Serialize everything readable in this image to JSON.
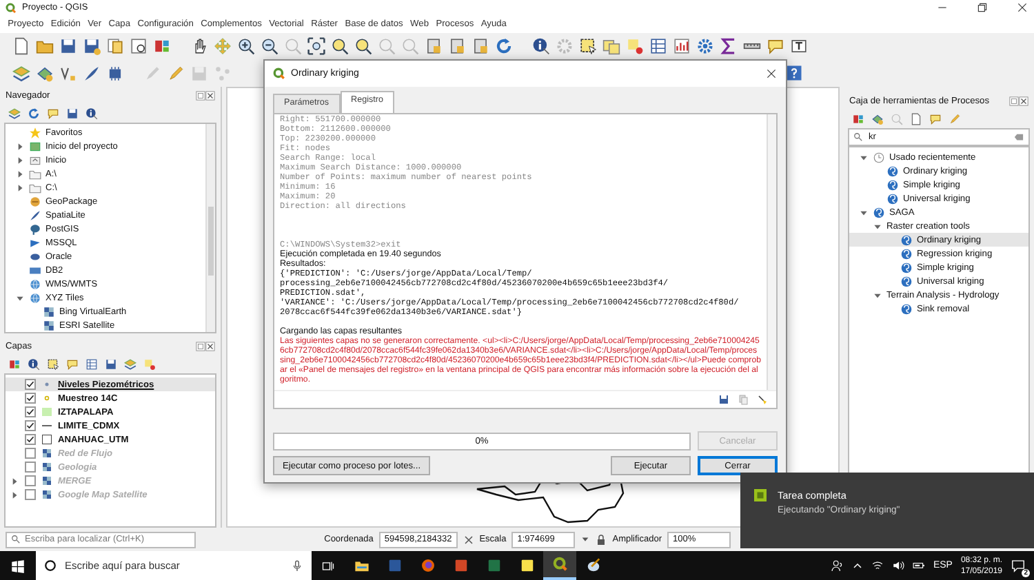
{
  "window": {
    "title": "Proyecto - QGIS"
  },
  "menu": [
    "Proyecto",
    "Edición",
    "Ver",
    "Capa",
    "Configuración",
    "Complementos",
    "Vectorial",
    "Ráster",
    "Base de datos",
    "Web",
    "Procesos",
    "Ayuda"
  ],
  "browser": {
    "title": "Navegador",
    "items": [
      {
        "label": "Favoritos",
        "kind": "favorites"
      },
      {
        "label": "Inicio del proyecto",
        "kind": "project",
        "expanded": false
      },
      {
        "label": "Inicio",
        "kind": "home",
        "expanded": false
      },
      {
        "label": "A:\\",
        "kind": "folder",
        "expanded": false
      },
      {
        "label": "C:\\",
        "kind": "folder",
        "expanded": false
      },
      {
        "label": "GeoPackage",
        "kind": "geopackage"
      },
      {
        "label": "SpatiaLite",
        "kind": "spatialite"
      },
      {
        "label": "PostGIS",
        "kind": "postgis"
      },
      {
        "label": "MSSQL",
        "kind": "mssql"
      },
      {
        "label": "Oracle",
        "kind": "oracle"
      },
      {
        "label": "DB2",
        "kind": "db2"
      },
      {
        "label": "WMS/WMTS",
        "kind": "wms"
      },
      {
        "label": "XYZ Tiles",
        "kind": "wms",
        "expanded": true,
        "children": [
          {
            "label": "Bing VirtualEarth",
            "kind": "tile"
          },
          {
            "label": "ESRI Satellite",
            "kind": "tile"
          }
        ]
      }
    ]
  },
  "layers": {
    "title": "Capas",
    "items": [
      {
        "label": "Niveles Piezométricos",
        "kind": "points",
        "checked": true,
        "selected": true
      },
      {
        "label": "Muestreo 14C",
        "kind": "points-hollow",
        "checked": true,
        "selected": false
      },
      {
        "label": "IZTAPALAPA",
        "kind": "polygon",
        "checked": true,
        "selected": false
      },
      {
        "label": "LIMITE_CDMX",
        "kind": "line",
        "checked": true,
        "selected": false
      },
      {
        "label": "ANAHUAC_UTM",
        "kind": "polygon-outline",
        "checked": true,
        "selected": false
      },
      {
        "label": "Red de Flujo",
        "kind": "raster",
        "checked": false,
        "selected": false
      },
      {
        "label": "Geologia",
        "kind": "raster",
        "checked": false,
        "selected": false
      },
      {
        "label": "MERGE",
        "kind": "raster",
        "checked": false,
        "selected": false,
        "expanded": false
      },
      {
        "label": "Google Map Satellite",
        "kind": "raster",
        "checked": false,
        "selected": false,
        "expanded": false
      }
    ]
  },
  "toolbox": {
    "title": "Caja de herramientas de Procesos",
    "search": {
      "value": "kr"
    },
    "items": [
      {
        "label": "Usado recientemente",
        "kind": "recent",
        "expanded": true,
        "selected": false,
        "children": [
          {
            "label": "Ordinary kriging",
            "kind": "algorithm",
            "selected": false
          },
          {
            "label": "Simple kriging",
            "kind": "algorithm",
            "selected": false
          },
          {
            "label": "Universal kriging",
            "kind": "algorithm",
            "selected": false
          }
        ]
      },
      {
        "label": "SAGA",
        "kind": "provider",
        "expanded": true,
        "selected": false,
        "children": [
          {
            "label": "Raster creation tools",
            "kind": "group",
            "expanded": true,
            "selected": false,
            "children": [
              {
                "label": "Ordinary kriging",
                "kind": "algorithm",
                "selected": true
              },
              {
                "label": "Regression kriging",
                "kind": "algorithm",
                "selected": false
              },
              {
                "label": "Simple kriging",
                "kind": "algorithm",
                "selected": false
              },
              {
                "label": "Universal kriging",
                "kind": "algorithm",
                "selected": false
              }
            ]
          },
          {
            "label": "Terrain Analysis - Hydrology",
            "kind": "group",
            "expanded": true,
            "selected": false,
            "children": [
              {
                "label": "Sink removal",
                "kind": "algorithm",
                "selected": false
              }
            ]
          }
        ]
      }
    ]
  },
  "dialog": {
    "title": "Ordinary kriging",
    "tabs": [
      {
        "label": "Parámetros",
        "selected": false
      },
      {
        "label": "Registro",
        "selected": true
      }
    ],
    "log": [
      {
        "kind": "console",
        "lines": [
          "Right: 551700.000000",
          "Bottom: 2112600.000000",
          "Top: 2230200.000000",
          "Fit: nodes",
          "Search Range: local",
          "Maximum Search Distance: 1000.000000",
          "Number of Points: maximum number of nearest points",
          "Minimum: 16",
          "Maximum: 20",
          "Direction: all directions"
        ]
      },
      {
        "kind": "console",
        "lines": [
          "C:\\WINDOWS\\System32>exit"
        ]
      },
      {
        "kind": "info",
        "lines": [
          "Ejecución completada en 19.40 segundos",
          "Resultados:"
        ]
      },
      {
        "kind": "result",
        "lines": [
          "{'PREDICTION': 'C:/Users/jorge/AppData/Local/Temp/",
          "processing_2eb6e7100042456cb772708cd2c4f80d/45236070200e4b659c65b1eee23bd3f4/",
          "PREDICTION.sdat',",
          "'VARIANCE': 'C:/Users/jorge/AppData/Local/Temp/processing_2eb6e7100042456cb772708cd2c4f80d/",
          "2078ccac6f544fc39fe062da1340b3e6/VARIANCE.sdat'}"
        ]
      },
      {
        "kind": "info",
        "lines": [
          "Cargando las capas resultantes"
        ]
      },
      {
        "kind": "error",
        "lines": [
          "Las siguientes capas no se generaron correctamente. <ul><li>C:/Users/jorge/AppData/Local/Temp/processing_2eb6e7100042456cb772708cd2c4f80d/2078ccac6f544fc39fe062da1340b3e6/VARIANCE.sdat</li><li>C:/Users/jorge/AppData/Local/Temp/processing_2eb6e7100042456cb772708cd2c4f80d/45236070200e4b659c65b1eee23bd3f4/PREDICTION.sdat</li></ul>Puede comprobar el «Panel de mensajes del registro» en la ventana principal de QGIS para encontrar más información sobre la ejecución del algoritmo."
        ]
      }
    ],
    "progress": {
      "level": 0,
      "text": "0%"
    },
    "buttons": [
      {
        "label": "Cancelar",
        "kind": "cancel",
        "disabled": true
      },
      {
        "label": "Ejecutar como proceso por lotes...",
        "kind": "batch",
        "disabled": false
      },
      {
        "label": "Ejecutar",
        "kind": "run",
        "disabled": false
      },
      {
        "label": "Cerrar",
        "kind": "close",
        "disabled": false
      }
    ]
  },
  "status_bar": {
    "locator": {
      "placeholder": "Escriba para localizar (Ctrl+K)"
    },
    "coordinate_label": "Coordenada",
    "coordinate": "594598,2184332",
    "scale_label": "Escala",
    "scale": "1:974699",
    "magnifier_label": "Amplificador",
    "magnifier": "100%"
  },
  "notification": {
    "title": "Tarea completa",
    "message": "Ejecutando \"Ordinary kriging\""
  },
  "taskbar": {
    "search": {
      "placeholder": "Escribe aquí para buscar"
    },
    "language": "ESP",
    "time": "08:32 p. m.",
    "date": "17/05/2019",
    "notifications_badge": "2"
  }
}
